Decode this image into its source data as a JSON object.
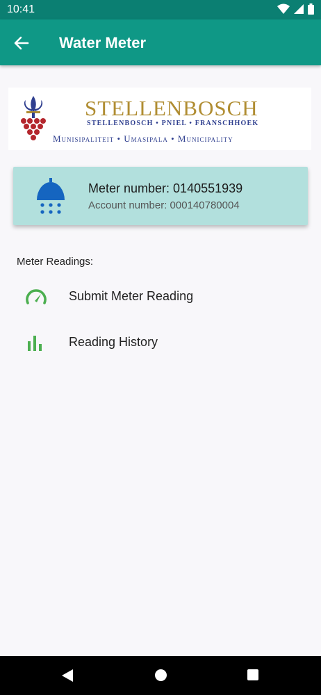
{
  "status_bar": {
    "time": "10:41"
  },
  "app_bar": {
    "title": "Water Meter"
  },
  "logo": {
    "name": "STELLENBOSCH",
    "subtitle": "STELLENBOSCH • PNIEL • FRANSCHHOEK",
    "tagline": "Munisipaliteit • Umasipala • Municipality"
  },
  "meter": {
    "meter_number": "Meter number: 0140551939",
    "account_number": "Account number: 000140780004"
  },
  "readings": {
    "section_label": "Meter Readings:",
    "items": [
      {
        "label": "Submit Meter Reading",
        "icon": "speedometer-icon"
      },
      {
        "label": "Reading History",
        "icon": "bar-chart-icon"
      }
    ]
  },
  "colors": {
    "status_bar": "#0b7f72",
    "app_bar": "#0f9886",
    "card": "#b2e0dd",
    "icon_green": "#4caf50",
    "icon_blue": "#1565c0"
  }
}
